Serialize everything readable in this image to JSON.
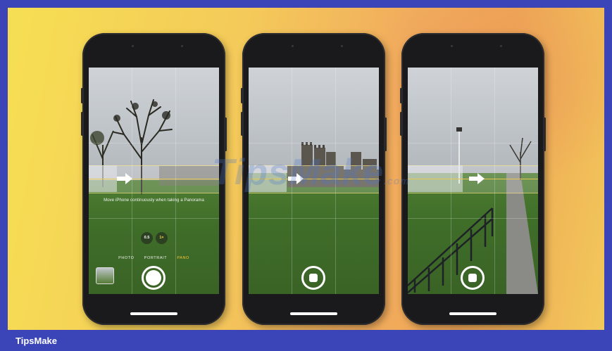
{
  "phones": [
    {
      "hint_text": "Move iPhone continuously when taking a Panorama",
      "zoom_options": [
        "0.5",
        "1×"
      ],
      "modes": [
        "PHOTO",
        "PORTRAIT",
        "PANO"
      ],
      "selected_mode": "PANO"
    },
    {},
    {}
  ],
  "watermark": {
    "text": "TipsMake",
    "suffix": ".com"
  },
  "footer": {
    "brand": "TipsMake"
  },
  "colors": {
    "background_start": "#f6df53",
    "background_end": "#eea656",
    "frame": "#3b45b8",
    "accent_yellow": "#f6c53a"
  }
}
